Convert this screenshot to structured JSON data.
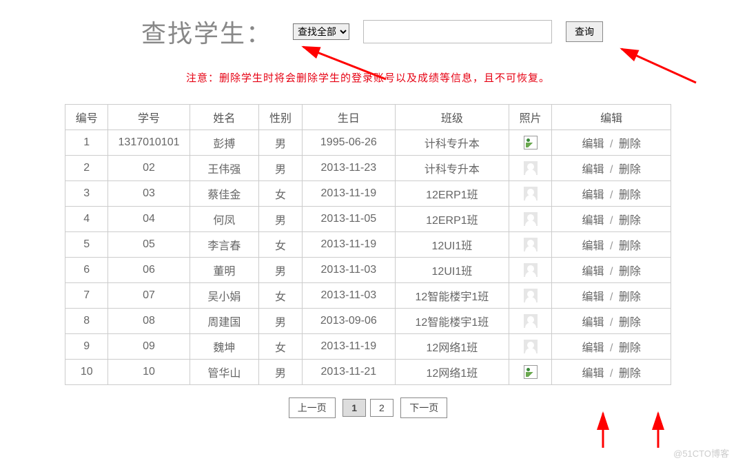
{
  "search": {
    "title": "查找学生：",
    "select_default": "查找全部",
    "input_value": "",
    "button_label": "查询"
  },
  "notice": "注意：删除学生时将会删除学生的登录账号以及成绩等信息，且不可恢复。",
  "columns": {
    "idx": "编号",
    "sid": "学号",
    "name": "姓名",
    "sex": "性别",
    "birthday": "生日",
    "class": "班级",
    "photo": "照片",
    "ops": "编辑"
  },
  "ops_labels": {
    "edit": "编辑",
    "delete": "删除"
  },
  "rows": [
    {
      "idx": "1",
      "sid": "1317010101",
      "name": "彭搏",
      "sex": "男",
      "birthday": "1995-06-26",
      "class": "计科专升本",
      "photo": "broken"
    },
    {
      "idx": "2",
      "sid": "02",
      "name": "王伟强",
      "sex": "男",
      "birthday": "2013-11-23",
      "class": "计科专升本",
      "photo": "placeholder"
    },
    {
      "idx": "3",
      "sid": "03",
      "name": "蔡佳金",
      "sex": "女",
      "birthday": "2013-11-19",
      "class": "12ERP1班",
      "photo": "placeholder"
    },
    {
      "idx": "4",
      "sid": "04",
      "name": "何凤",
      "sex": "男",
      "birthday": "2013-11-05",
      "class": "12ERP1班",
      "photo": "placeholder"
    },
    {
      "idx": "5",
      "sid": "05",
      "name": "李言春",
      "sex": "女",
      "birthday": "2013-11-19",
      "class": "12UI1班",
      "photo": "placeholder"
    },
    {
      "idx": "6",
      "sid": "06",
      "name": "董明",
      "sex": "男",
      "birthday": "2013-11-03",
      "class": "12UI1班",
      "photo": "placeholder"
    },
    {
      "idx": "7",
      "sid": "07",
      "name": "吴小娟",
      "sex": "女",
      "birthday": "2013-11-03",
      "class": "12智能楼宇1班",
      "photo": "placeholder"
    },
    {
      "idx": "8",
      "sid": "08",
      "name": "周建国",
      "sex": "男",
      "birthday": "2013-09-06",
      "class": "12智能楼宇1班",
      "photo": "placeholder"
    },
    {
      "idx": "9",
      "sid": "09",
      "name": "魏坤",
      "sex": "女",
      "birthday": "2013-11-19",
      "class": "12网络1班",
      "photo": "placeholder"
    },
    {
      "idx": "10",
      "sid": "10",
      "name": "管华山",
      "sex": "男",
      "birthday": "2013-11-21",
      "class": "12网络1班",
      "photo": "broken"
    }
  ],
  "pager": {
    "prev": "上一页",
    "next": "下一页",
    "pages": [
      "1",
      "2"
    ],
    "current": "1"
  },
  "watermark": "@51CTO博客",
  "arrows_color": "#ff0000"
}
